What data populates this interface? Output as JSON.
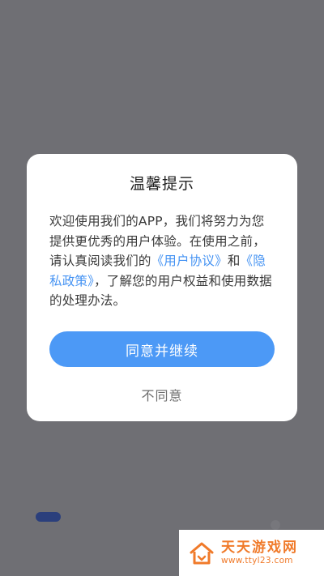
{
  "dialog": {
    "title": "温馨提示",
    "body": {
      "text1": "欢迎使用我们的APP，我们将努力为您提供更优秀的用户体验。在使用之前，请认真阅读我们的",
      "link_user_agreement": "《用户协议》",
      "text2": "和",
      "link_privacy_policy": "《隐私政策》",
      "text3": "，了解您的用户权益和使用数据的处理办法。"
    },
    "agree_label": "同意并继续",
    "disagree_label": "不同意"
  },
  "watermark": {
    "name": "天天游戏网",
    "url": "www.ttyl23.com"
  },
  "colors": {
    "overlay": "#6f6f74",
    "accent": "#4c99f6",
    "link": "#4593f3",
    "watermark": "#f07a2a"
  },
  "icons": {
    "watermark_logo": "house-logo-icon"
  }
}
